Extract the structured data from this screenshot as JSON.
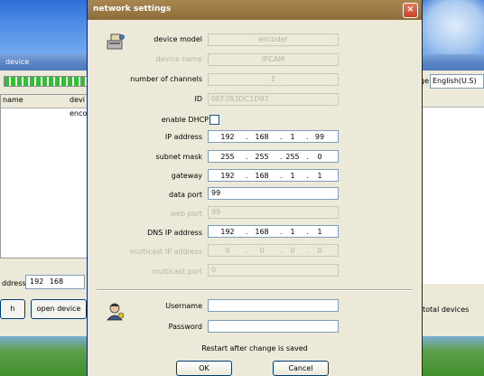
{
  "background": {
    "app_title": "device",
    "list_columns": [
      "name",
      "devi"
    ],
    "list_cell": "enco",
    "address_label": "ddress",
    "address_octets": [
      "192",
      "168"
    ],
    "search_label": "h",
    "open_device_label": "open device",
    "language_label": "ge",
    "language_value": "English(U.S)",
    "total_devices_label": "total devices"
  },
  "dialog": {
    "title": "network settings",
    "close_label": "×",
    "device_model_label": "device model",
    "device_model_value": "encoder",
    "device_name_label": "device name",
    "device_name_value": "IPCAM",
    "channels_label": "number of channels",
    "channels_value": "1",
    "id_label": "ID",
    "id_value": "0EF2B3DC1D97",
    "dhcp_label": "enable DHCP",
    "ip_label": "IP address",
    "ip_value": [
      "192",
      "168",
      "1",
      "99"
    ],
    "subnet_label": "subnet mask",
    "subnet_value": [
      "255",
      "255",
      "255",
      "0"
    ],
    "gateway_label": "gateway",
    "gateway_value": [
      "192",
      "168",
      "1",
      "1"
    ],
    "data_port_label": "data port",
    "data_port_value": "99",
    "web_port_label": "web port",
    "web_port_value": "99",
    "dns_label": "DNS IP address",
    "dns_value": [
      "192",
      "168",
      "1",
      "1"
    ],
    "multicast_ip_label": "multicast IP address",
    "multicast_ip_value": [
      "0",
      "0",
      "0",
      "0"
    ],
    "multicast_port_label": "multicast port",
    "multicast_port_value": "0",
    "username_label": "Username",
    "username_value": "",
    "password_label": "Password",
    "password_value": "",
    "note": "Restart after change is saved",
    "ok_label": "OK",
    "cancel_label": "Cancel"
  }
}
